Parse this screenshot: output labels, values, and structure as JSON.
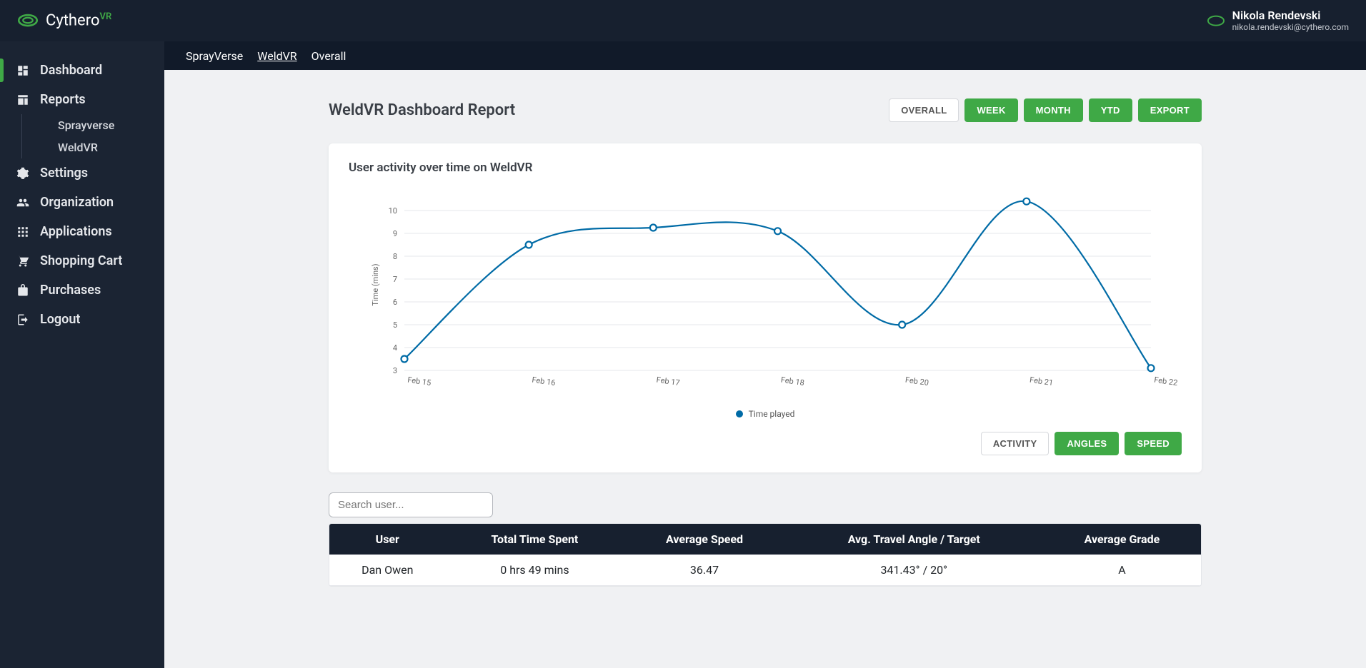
{
  "brand": {
    "name": "Cythero",
    "suffix": "VR"
  },
  "user": {
    "name": "Nikola Rendevski",
    "email": "nikola.rendevski@cythero.com"
  },
  "sidebar": {
    "items": [
      {
        "label": "Dashboard"
      },
      {
        "label": "Reports"
      },
      {
        "label": "Settings"
      },
      {
        "label": "Organization"
      },
      {
        "label": "Applications"
      },
      {
        "label": "Shopping Cart"
      },
      {
        "label": "Purchases"
      },
      {
        "label": "Logout"
      }
    ],
    "reports_children": [
      {
        "label": "Sprayverse"
      },
      {
        "label": "WeldVR"
      }
    ]
  },
  "tabs": {
    "sprayverse": "SprayVerse",
    "weldvr": "WeldVR",
    "overall": "Overall"
  },
  "page": {
    "title": "WeldVR Dashboard Report"
  },
  "range_buttons": {
    "overall": "OVERALL",
    "week": "WEEK",
    "month": "MONTH",
    "ytd": "YTD",
    "export": "EXPORT"
  },
  "chart_panel": {
    "title": "User activity over time on WeldVR",
    "legend": "Time played"
  },
  "metric_buttons": {
    "activity": "ACTIVITY",
    "angles": "ANGLES",
    "speed": "SPEED"
  },
  "search": {
    "placeholder": "Search user..."
  },
  "table": {
    "headers": {
      "user": "User",
      "time": "Total Time Spent",
      "speed": "Average Speed",
      "angle": "Avg. Travel Angle / Target",
      "grade": "Average Grade"
    },
    "rows": [
      {
        "user": "Dan Owen",
        "time": "0 hrs 49 mins",
        "speed": "36.47",
        "angle": "341.43° / 20°",
        "grade": "A"
      }
    ]
  },
  "chart_data": {
    "type": "line",
    "title": "User activity over time on WeldVR",
    "xlabel": "",
    "ylabel": "Time (mins)",
    "ylim": [
      3,
      10.5
    ],
    "yticks": [
      3,
      4,
      5,
      6,
      7,
      8,
      9,
      10
    ],
    "categories": [
      "Feb 15",
      "Feb 16",
      "Feb 17",
      "Feb 18",
      "Feb 20",
      "Feb 21",
      "Feb 22"
    ],
    "series": [
      {
        "name": "Time played",
        "values": [
          3.5,
          8.5,
          9.25,
          9.1,
          5.0,
          10.4,
          3.1
        ]
      }
    ]
  }
}
